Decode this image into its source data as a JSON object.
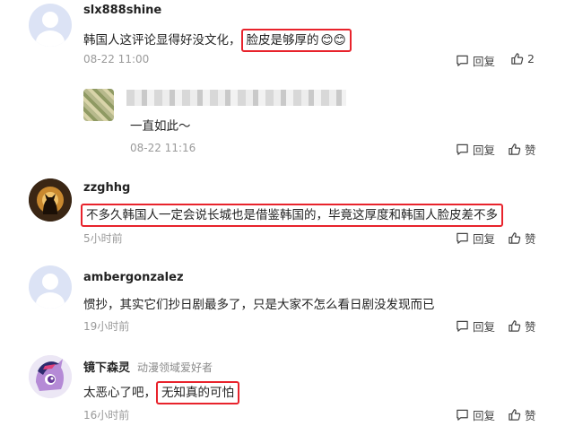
{
  "comments": [
    {
      "username": "slx888shine",
      "text_plain": "韩国人这评论显得好没文化，",
      "text_highlight": "脸皮是够厚的",
      "emoji": "😊😊",
      "time": "08-22 11:00",
      "reply_label": "回复",
      "like_label": "2"
    },
    {
      "username": "zzghhg",
      "text_highlight": "不多久韩国人一定会说长城也是借鉴韩国的，毕竟这厚度和韩国人脸皮差不多",
      "time": "5小时前",
      "reply_label": "回复",
      "like_label": "赞"
    },
    {
      "username": "ambergonzalez",
      "text_plain": "惯抄，其实它们抄日剧最多了，只是大家不怎么看日剧没发现而已",
      "time": "19小时前",
      "reply_label": "回复",
      "like_label": "赞"
    },
    {
      "username": "镜下森灵",
      "badge": "动漫领域爱好者",
      "text_plain": "太恶心了吧，",
      "text_highlight": "无知真的可怕",
      "time": "16小时前",
      "reply_label": "回复",
      "like_label": "赞"
    }
  ],
  "reply": {
    "text": "一直如此～",
    "time": "08-22 11:16",
    "reply_label": "回复",
    "like_label": "赞"
  },
  "icons": {
    "reply": "comment-bubble-icon",
    "like": "thumbs-up-icon"
  },
  "colors": {
    "highlight_border": "#e8232c",
    "meta_text": "#9a9a9a",
    "default_avatar": "#dce3f5"
  }
}
